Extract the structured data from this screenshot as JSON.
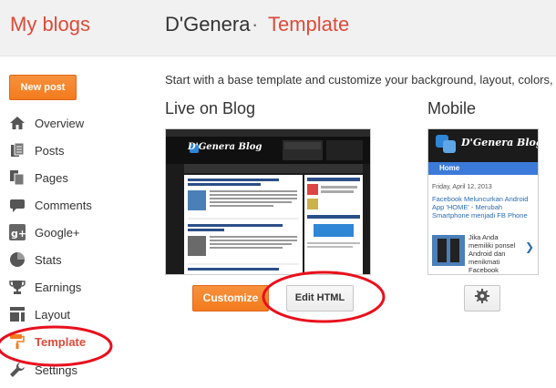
{
  "header": {
    "app_title": "My blogs",
    "blog_name": "D'Genera",
    "separator": "·",
    "section": "Template"
  },
  "sidebar": {
    "new_post_label": "New post",
    "items": [
      {
        "label": "Overview",
        "icon": "home-icon"
      },
      {
        "label": "Posts",
        "icon": "posts-icon"
      },
      {
        "label": "Pages",
        "icon": "pages-icon"
      },
      {
        "label": "Comments",
        "icon": "comments-icon"
      },
      {
        "label": "Google+",
        "icon": "google-plus-icon"
      },
      {
        "label": "Stats",
        "icon": "stats-icon"
      },
      {
        "label": "Earnings",
        "icon": "trophy-icon"
      },
      {
        "label": "Layout",
        "icon": "layout-icon"
      },
      {
        "label": "Template",
        "icon": "paint-roller-icon",
        "active": true
      },
      {
        "label": "Settings",
        "icon": "wrench-icon"
      }
    ]
  },
  "main": {
    "intro": "Start with a base template and customize your background, layout, colors,",
    "live": {
      "title": "Live on Blog",
      "preview_logo": "D'Genera Blog",
      "customize_label": "Customize",
      "edit_html_label": "Edit HTML"
    },
    "mobile": {
      "title": "Mobile",
      "preview_logo": "D'Genera Blog",
      "nav_home": "Home",
      "date": "Friday, April 12, 2013",
      "post_title": "Facebook Meluncurkan Android App 'HOME' - Merubah Smartphone menjadi FB Phone",
      "excerpt": "Jika Anda memiliki ponsel Android dan menikmati Facebook"
    }
  },
  "colors": {
    "accent": "#dd4b39",
    "orange_button": "#f37b1d",
    "annotation": "#e8101c"
  }
}
